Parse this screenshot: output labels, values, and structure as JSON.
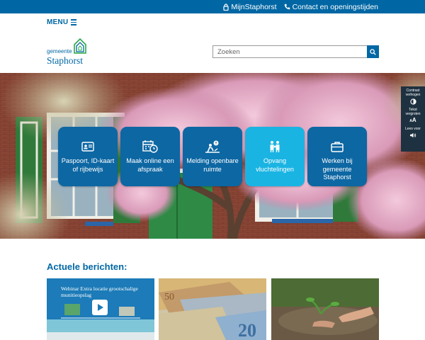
{
  "topbar": {
    "mijn_label": "MijnStaphorst",
    "contact_label": "Contact en openingstijden"
  },
  "header": {
    "menu_label": "MENU",
    "logo_small": "gemeente",
    "logo_big": "Staphorst"
  },
  "search": {
    "placeholder": "Zoeken"
  },
  "tiles": [
    {
      "label": "Paspoort, ID-kaart of rijbewijs",
      "icon": "id-card-icon"
    },
    {
      "label": "Maak online een afspraak",
      "icon": "calendar-clock-icon"
    },
    {
      "label": "Melding openbare ruimte",
      "icon": "report-person-icon"
    },
    {
      "label": "Opvang vluchtelingen",
      "icon": "family-icon"
    },
    {
      "label": "Werken bij gemeente Staphorst",
      "icon": "briefcase-icon"
    }
  ],
  "sidetools": {
    "contrast_label": "Contrast verhogen",
    "text_label": "Tekst vergroten",
    "text_symbol": "A",
    "read_label": "Lees voor"
  },
  "news": {
    "title": "Actuele berichten:",
    "items": [
      {
        "caption": "Webinar Extra locatie grootschalige munitieopslag",
        "image": "webinar-thumbnail"
      },
      {
        "caption": "",
        "image": "euro-banknotes-photo"
      },
      {
        "caption": "",
        "image": "planting-seedling-photo"
      }
    ]
  },
  "colors": {
    "brand_blue": "#0067a4",
    "tile_blue": "#0d67a3",
    "tile_light": "#1ab4e3",
    "tool_dark": "#1e3140"
  }
}
